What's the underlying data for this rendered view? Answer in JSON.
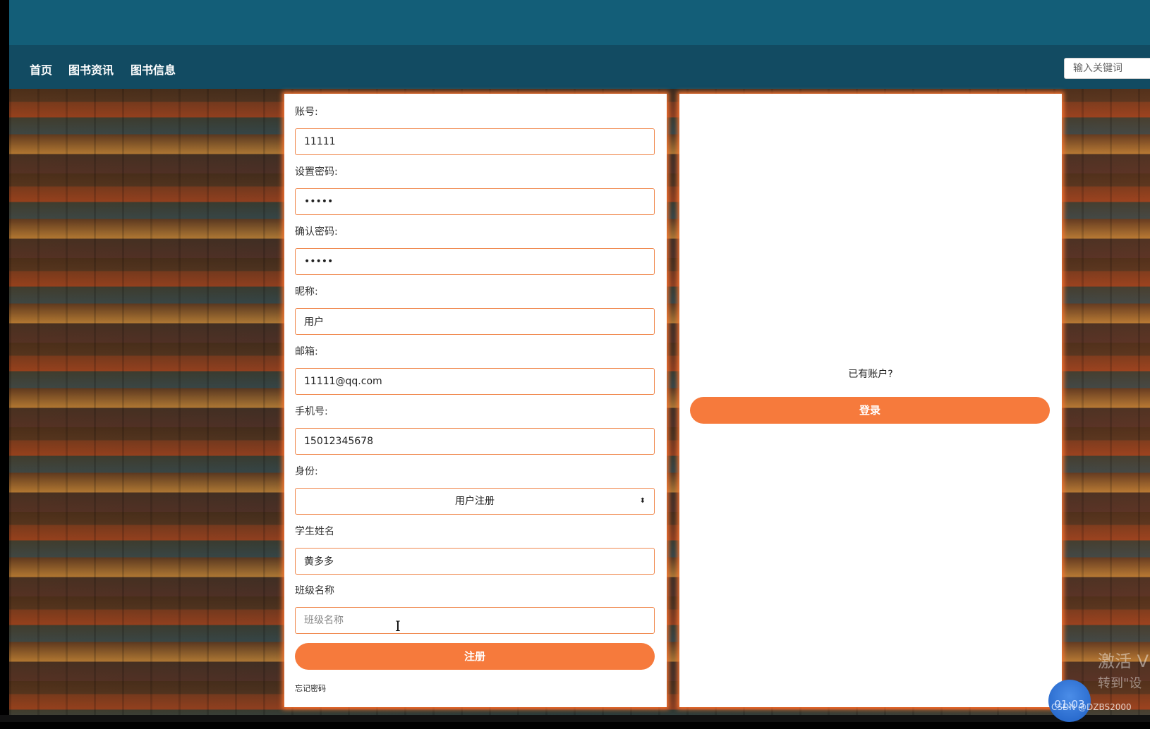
{
  "nav": {
    "items": [
      "首页",
      "图书资讯",
      "图书信息"
    ],
    "search_placeholder": "输入关键词"
  },
  "form": {
    "fields": [
      {
        "label": "账号:",
        "value": "11111",
        "type": "text"
      },
      {
        "label": "设置密码:",
        "value": "11111",
        "type": "password"
      },
      {
        "label": "确认密码:",
        "value": "11111",
        "type": "password"
      },
      {
        "label": "昵称:",
        "value": "用户",
        "type": "text"
      },
      {
        "label": "邮箱:",
        "value": "11111@qq.com",
        "type": "text"
      },
      {
        "label": "手机号:",
        "value": "15012345678",
        "type": "text"
      }
    ],
    "role_label": "身份:",
    "role_value": "用户注册",
    "student_name_label": "学生姓名",
    "student_name_value": "黄多多",
    "class_name_label": "班级名称",
    "class_name_placeholder": "班级名称",
    "register_label": "注册",
    "forgot_label": "忘记密码"
  },
  "side": {
    "prompt": "已有账户?",
    "login_label": "登录"
  },
  "overlay": {
    "watermark_line1": "激活 V",
    "watermark_line2": "转到\"设",
    "timer": "01:03",
    "credit": "CSDN @DZBS2000"
  }
}
